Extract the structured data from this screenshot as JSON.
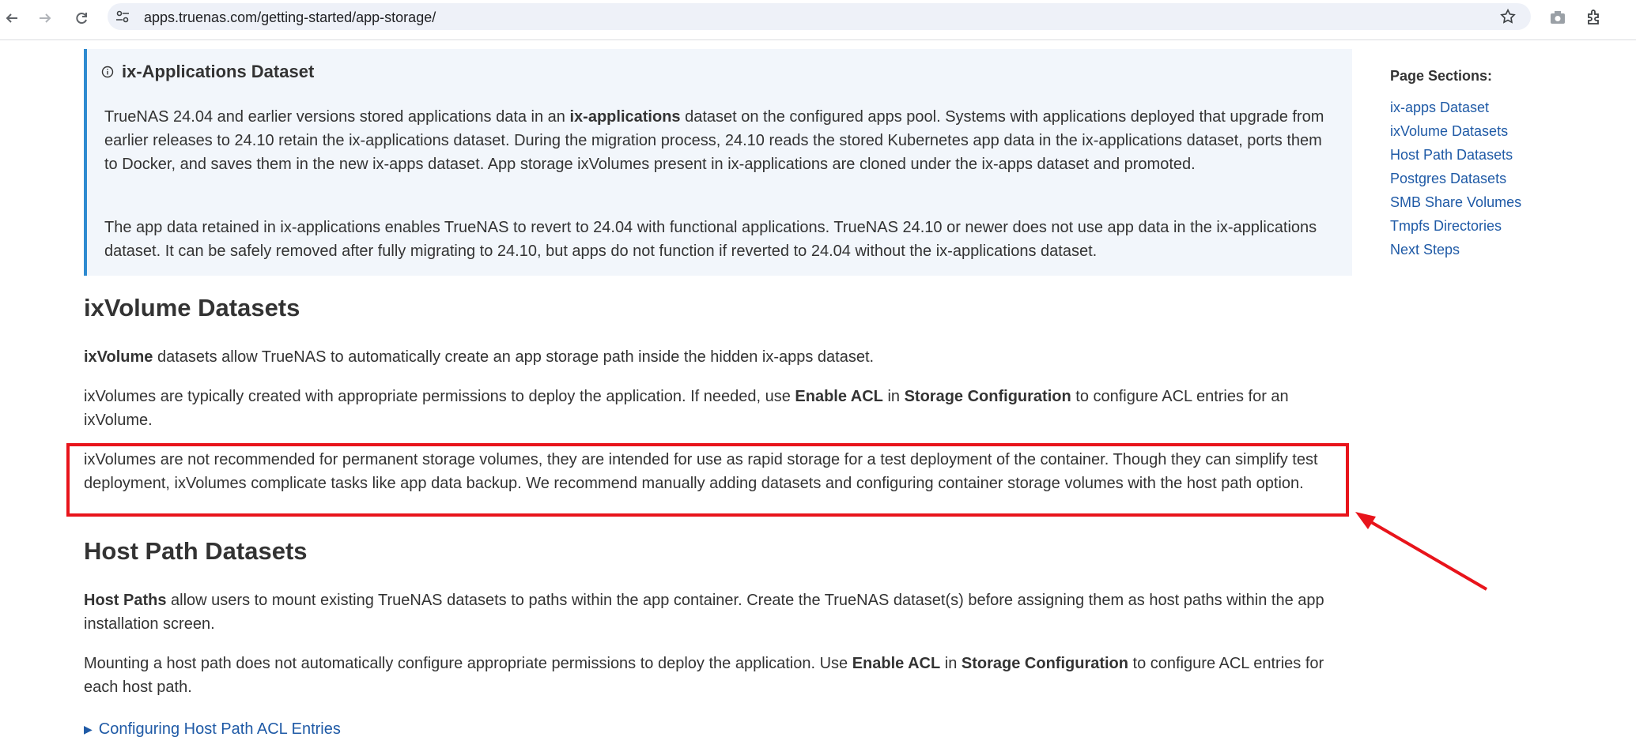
{
  "browser": {
    "url": "apps.truenas.com/getting-started/app-storage/"
  },
  "callout": {
    "title": "ix-Applications Dataset",
    "p1_a": "TrueNAS 24.04 and earlier versions stored applications data in an ",
    "p1_bold": "ix-applications",
    "p1_b": " dataset on the configured apps pool. Systems with applications deployed that upgrade from earlier releases to 24.10 retain the ix-applications dataset. During the migration process, 24.10 reads the stored Kubernetes app data in the ix-applications dataset, ports them to Docker, and saves them in the new ix-apps dataset. App storage ixVolumes present in ix-applications are cloned under the ix-apps dataset and promoted.",
    "p2": "The app data retained in ix-applications enables TrueNAS to revert to 24.04 with functional applications. TrueNAS 24.10 or newer does not use app data in the ix-applications dataset. It can be safely removed after fully migrating to 24.10, but apps do not function if reverted to 24.04 without the ix-applications dataset."
  },
  "ixvolume": {
    "heading": "ixVolume Datasets",
    "p1_bold": "ixVolume",
    "p1_rest": " datasets allow TrueNAS to automatically create an app storage path inside the hidden ix-apps dataset.",
    "p2_a": "ixVolumes are typically created with appropriate permissions to deploy the application. If needed, use ",
    "p2_bold1": "Enable ACL",
    "p2_b": " in ",
    "p2_bold2": "Storage Configuration",
    "p2_c": " to configure ACL entries for an ixVolume.",
    "p3": "ixVolumes are not recommended for permanent storage volumes, they are intended for use as rapid storage for a test deployment of the container. Though they can simplify test deployment, ixVolumes complicate tasks like app data backup. We recommend manually adding datasets and configuring container storage volumes with the host path option."
  },
  "hostpath": {
    "heading": "Host Path Datasets",
    "p1_bold": "Host Paths",
    "p1_rest": " allow users to mount existing TrueNAS datasets to paths within the app container. Create the TrueNAS dataset(s) before assigning them as host paths within the app installation screen.",
    "p2_a": "Mounting a host path does not automatically configure appropriate permissions to deploy the application. Use ",
    "p2_bold1": "Enable ACL",
    "p2_b": " in ",
    "p2_bold2": "Storage Configuration",
    "p2_c": " to configure ACL entries for each host path.",
    "details_label": "Configuring Host Path ACL Entries"
  },
  "sidebar": {
    "title": "Page Sections:",
    "links": [
      "ix-apps Dataset",
      "ixVolume Datasets",
      "Host Path Datasets",
      "Postgres Datasets",
      "SMB Share Volumes",
      "Tmpfs Directories",
      "Next Steps"
    ]
  },
  "colors": {
    "accent_link": "#1f5aa6",
    "callout_border": "#2e8bd0",
    "annotation_red": "#e8141b"
  }
}
